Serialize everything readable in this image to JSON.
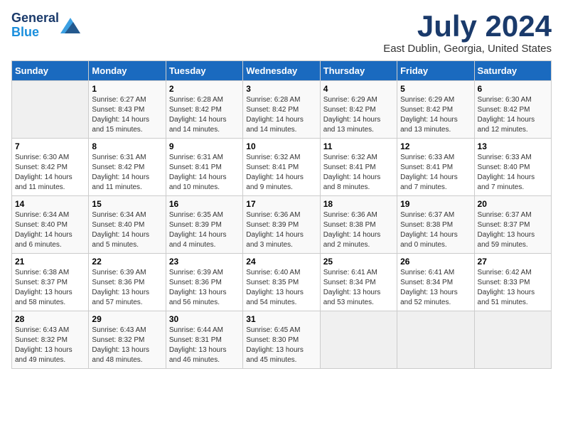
{
  "header": {
    "logo_line1": "General",
    "logo_line2": "Blue",
    "title": "July 2024",
    "subtitle": "East Dublin, Georgia, United States"
  },
  "days_of_week": [
    "Sunday",
    "Monday",
    "Tuesday",
    "Wednesday",
    "Thursday",
    "Friday",
    "Saturday"
  ],
  "weeks": [
    [
      {
        "num": "",
        "info": ""
      },
      {
        "num": "1",
        "info": "Sunrise: 6:27 AM\nSunset: 8:43 PM\nDaylight: 14 hours\nand 15 minutes."
      },
      {
        "num": "2",
        "info": "Sunrise: 6:28 AM\nSunset: 8:42 PM\nDaylight: 14 hours\nand 14 minutes."
      },
      {
        "num": "3",
        "info": "Sunrise: 6:28 AM\nSunset: 8:42 PM\nDaylight: 14 hours\nand 14 minutes."
      },
      {
        "num": "4",
        "info": "Sunrise: 6:29 AM\nSunset: 8:42 PM\nDaylight: 14 hours\nand 13 minutes."
      },
      {
        "num": "5",
        "info": "Sunrise: 6:29 AM\nSunset: 8:42 PM\nDaylight: 14 hours\nand 13 minutes."
      },
      {
        "num": "6",
        "info": "Sunrise: 6:30 AM\nSunset: 8:42 PM\nDaylight: 14 hours\nand 12 minutes."
      }
    ],
    [
      {
        "num": "7",
        "info": "Sunrise: 6:30 AM\nSunset: 8:42 PM\nDaylight: 14 hours\nand 11 minutes."
      },
      {
        "num": "8",
        "info": "Sunrise: 6:31 AM\nSunset: 8:42 PM\nDaylight: 14 hours\nand 11 minutes."
      },
      {
        "num": "9",
        "info": "Sunrise: 6:31 AM\nSunset: 8:41 PM\nDaylight: 14 hours\nand 10 minutes."
      },
      {
        "num": "10",
        "info": "Sunrise: 6:32 AM\nSunset: 8:41 PM\nDaylight: 14 hours\nand 9 minutes."
      },
      {
        "num": "11",
        "info": "Sunrise: 6:32 AM\nSunset: 8:41 PM\nDaylight: 14 hours\nand 8 minutes."
      },
      {
        "num": "12",
        "info": "Sunrise: 6:33 AM\nSunset: 8:41 PM\nDaylight: 14 hours\nand 7 minutes."
      },
      {
        "num": "13",
        "info": "Sunrise: 6:33 AM\nSunset: 8:40 PM\nDaylight: 14 hours\nand 7 minutes."
      }
    ],
    [
      {
        "num": "14",
        "info": "Sunrise: 6:34 AM\nSunset: 8:40 PM\nDaylight: 14 hours\nand 6 minutes."
      },
      {
        "num": "15",
        "info": "Sunrise: 6:34 AM\nSunset: 8:40 PM\nDaylight: 14 hours\nand 5 minutes."
      },
      {
        "num": "16",
        "info": "Sunrise: 6:35 AM\nSunset: 8:39 PM\nDaylight: 14 hours\nand 4 minutes."
      },
      {
        "num": "17",
        "info": "Sunrise: 6:36 AM\nSunset: 8:39 PM\nDaylight: 14 hours\nand 3 minutes."
      },
      {
        "num": "18",
        "info": "Sunrise: 6:36 AM\nSunset: 8:38 PM\nDaylight: 14 hours\nand 2 minutes."
      },
      {
        "num": "19",
        "info": "Sunrise: 6:37 AM\nSunset: 8:38 PM\nDaylight: 14 hours\nand 0 minutes."
      },
      {
        "num": "20",
        "info": "Sunrise: 6:37 AM\nSunset: 8:37 PM\nDaylight: 13 hours\nand 59 minutes."
      }
    ],
    [
      {
        "num": "21",
        "info": "Sunrise: 6:38 AM\nSunset: 8:37 PM\nDaylight: 13 hours\nand 58 minutes."
      },
      {
        "num": "22",
        "info": "Sunrise: 6:39 AM\nSunset: 8:36 PM\nDaylight: 13 hours\nand 57 minutes."
      },
      {
        "num": "23",
        "info": "Sunrise: 6:39 AM\nSunset: 8:36 PM\nDaylight: 13 hours\nand 56 minutes."
      },
      {
        "num": "24",
        "info": "Sunrise: 6:40 AM\nSunset: 8:35 PM\nDaylight: 13 hours\nand 54 minutes."
      },
      {
        "num": "25",
        "info": "Sunrise: 6:41 AM\nSunset: 8:34 PM\nDaylight: 13 hours\nand 53 minutes."
      },
      {
        "num": "26",
        "info": "Sunrise: 6:41 AM\nSunset: 8:34 PM\nDaylight: 13 hours\nand 52 minutes."
      },
      {
        "num": "27",
        "info": "Sunrise: 6:42 AM\nSunset: 8:33 PM\nDaylight: 13 hours\nand 51 minutes."
      }
    ],
    [
      {
        "num": "28",
        "info": "Sunrise: 6:43 AM\nSunset: 8:32 PM\nDaylight: 13 hours\nand 49 minutes."
      },
      {
        "num": "29",
        "info": "Sunrise: 6:43 AM\nSunset: 8:32 PM\nDaylight: 13 hours\nand 48 minutes."
      },
      {
        "num": "30",
        "info": "Sunrise: 6:44 AM\nSunset: 8:31 PM\nDaylight: 13 hours\nand 46 minutes."
      },
      {
        "num": "31",
        "info": "Sunrise: 6:45 AM\nSunset: 8:30 PM\nDaylight: 13 hours\nand 45 minutes."
      },
      {
        "num": "",
        "info": ""
      },
      {
        "num": "",
        "info": ""
      },
      {
        "num": "",
        "info": ""
      }
    ]
  ]
}
